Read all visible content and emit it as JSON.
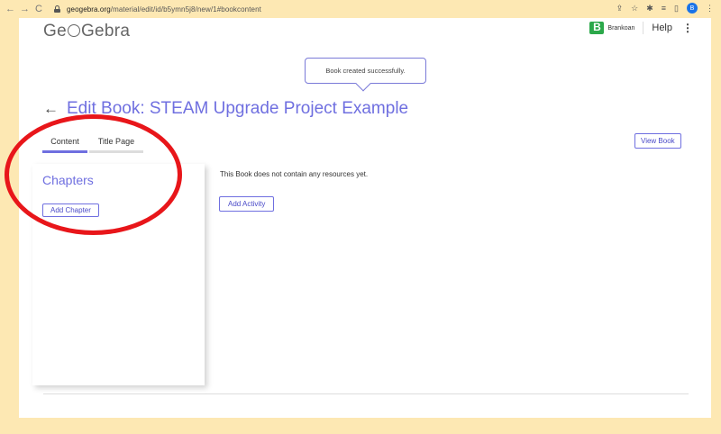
{
  "browser": {
    "back": "←",
    "forward": "→",
    "reload": "C",
    "url_host": "geogebra.org",
    "url_path": "/material/edit/id/b5ymn5j8/new/1#bookcontent",
    "profile_initial": "B"
  },
  "header": {
    "logo_left": "Ge",
    "logo_right": "Gebra",
    "user_initial": "B",
    "user_name": "Brankoan",
    "help": "Help",
    "menu": "⋮"
  },
  "toast": {
    "message": "Book created successfully."
  },
  "page": {
    "back": "←",
    "title": "Edit Book: STEAM Upgrade Project Example"
  },
  "tabs": [
    {
      "label": "Content",
      "active": true
    },
    {
      "label": "Title Page",
      "active": false
    }
  ],
  "actions": {
    "view_book": "View Book"
  },
  "sidebar": {
    "heading": "Chapters",
    "add_chapter": "Add Chapter"
  },
  "main": {
    "empty_message": "This Book does not contain any resources yet.",
    "add_activity": "Add Activity"
  },
  "colors": {
    "accent": "#6f6fe0",
    "annotation": "#e8161a",
    "background": "#fde8b3"
  }
}
